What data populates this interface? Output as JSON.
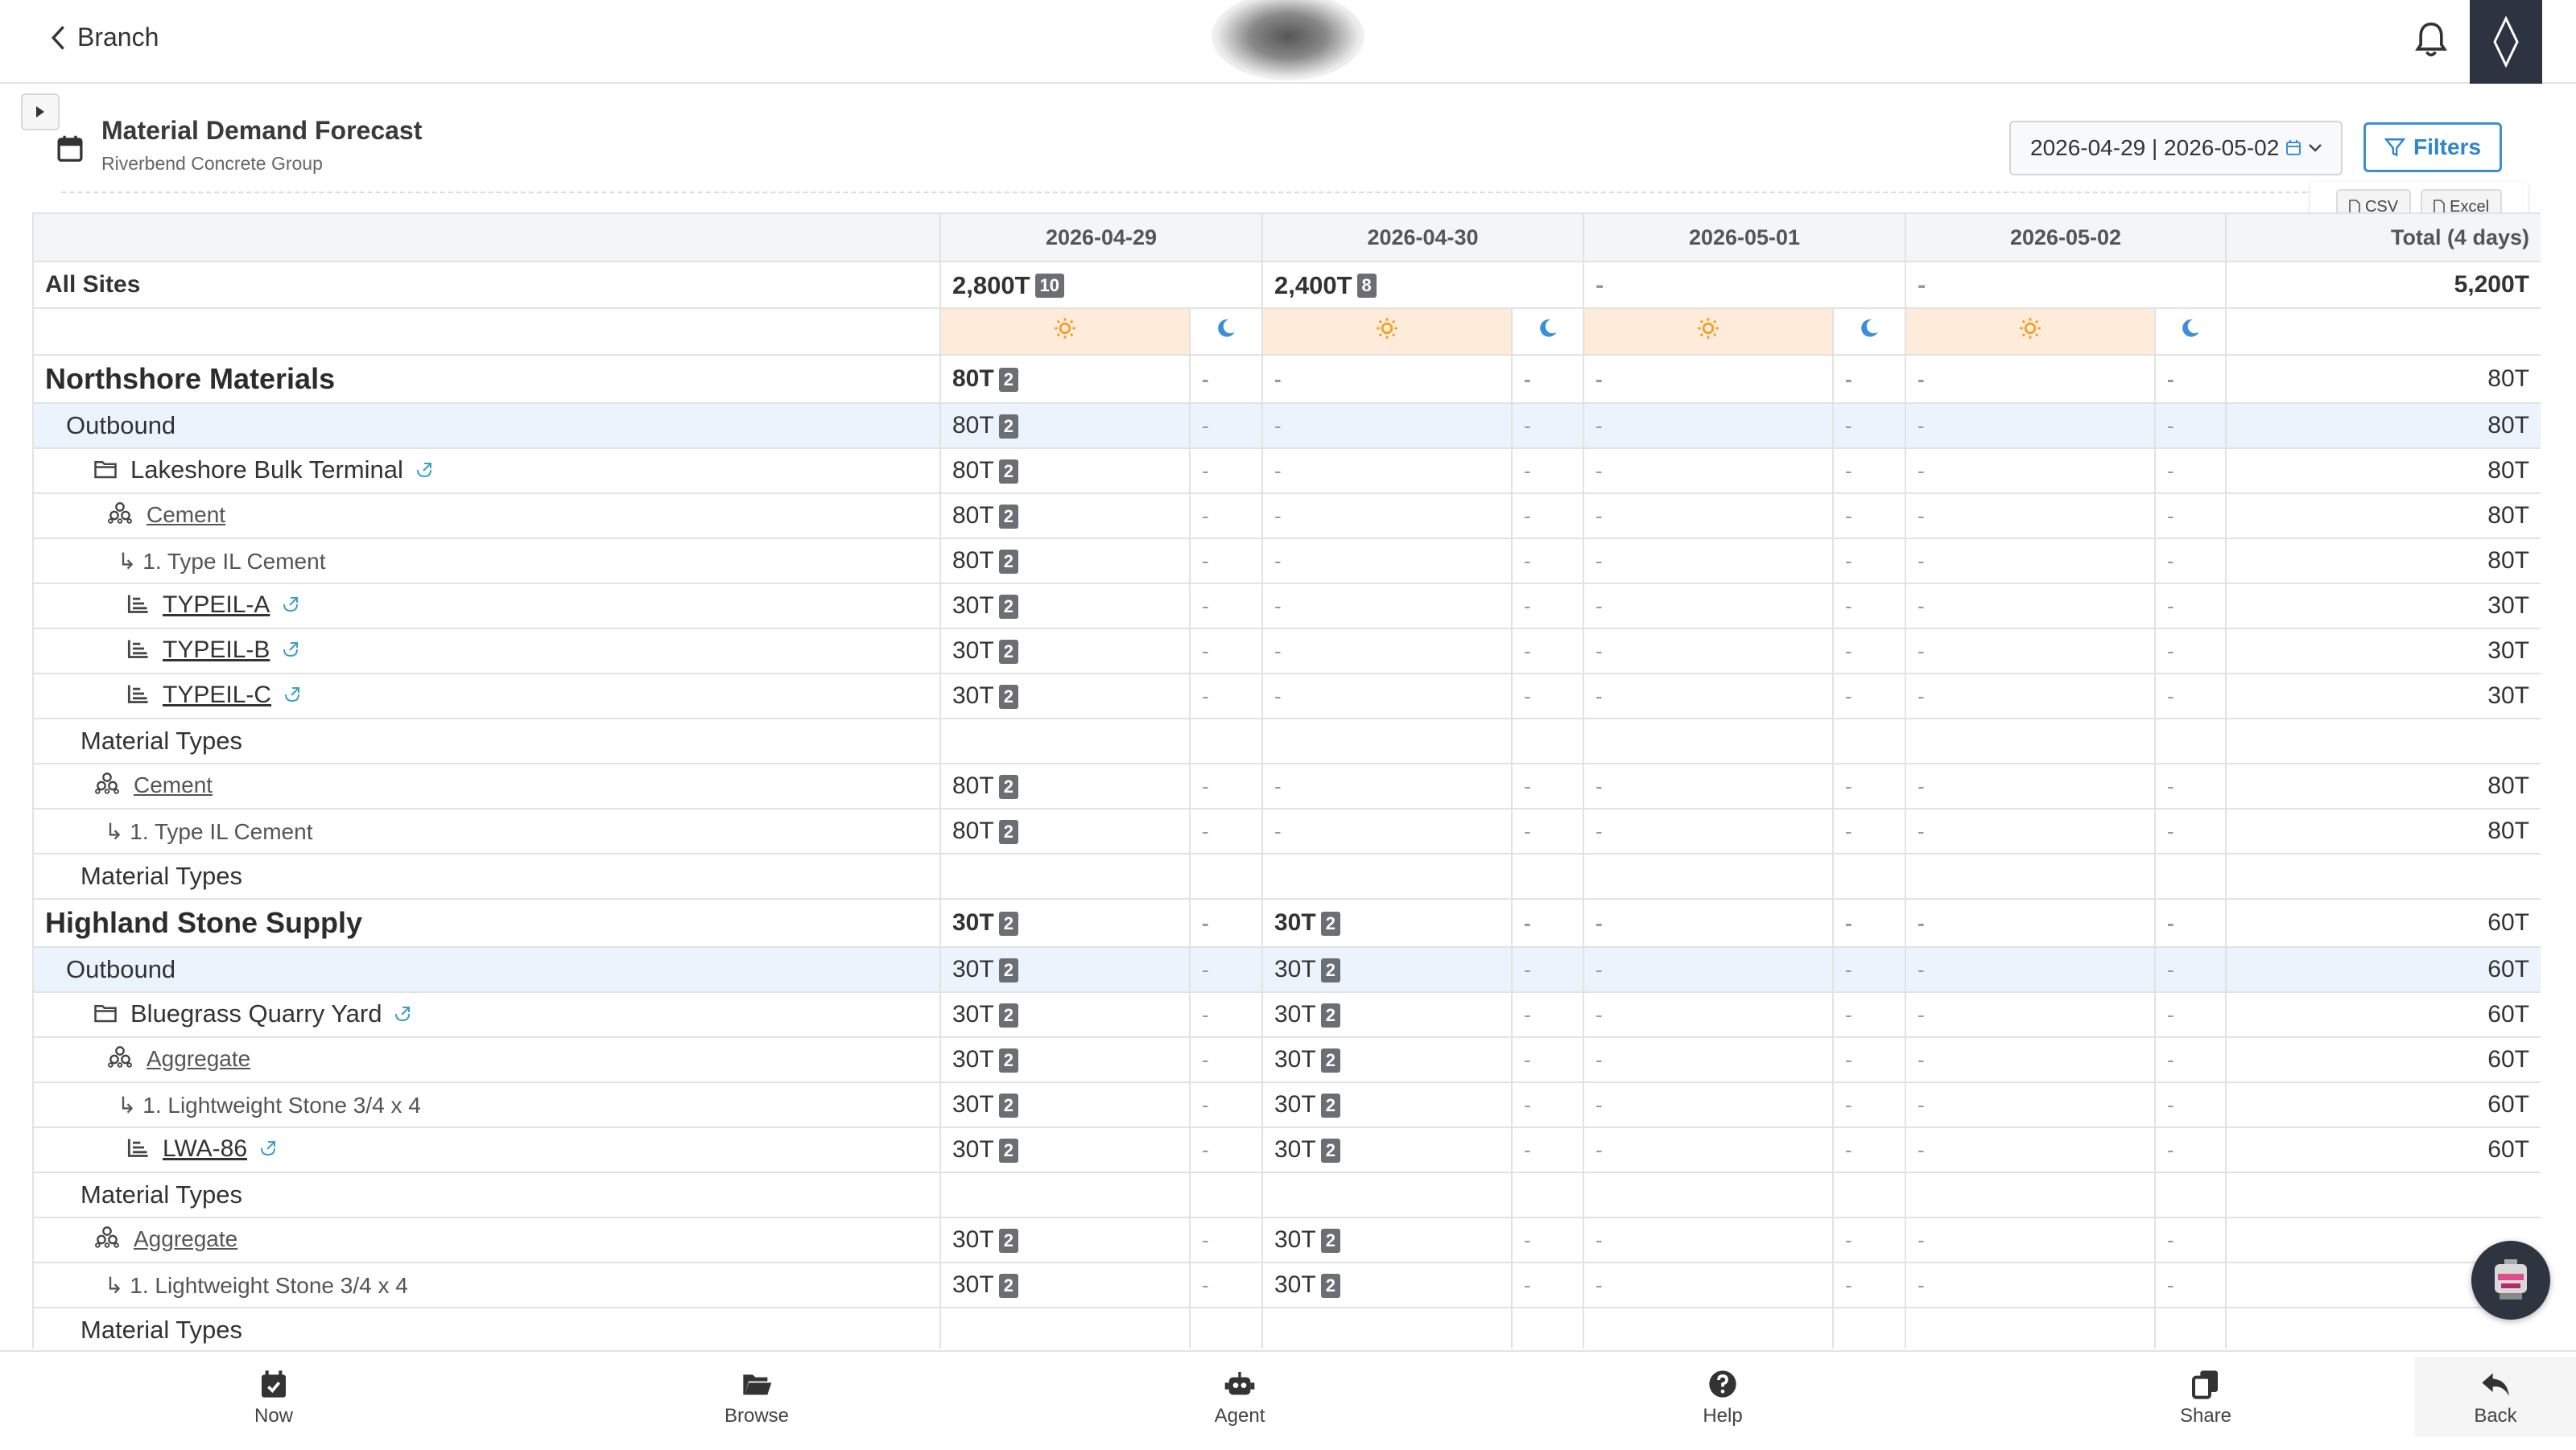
{
  "topbar": {
    "back_label": "Branch"
  },
  "header": {
    "title": "Material Demand Forecast",
    "subtitle": "Riverbend Concrete Group",
    "date_range": "2026-04-29 | 2026-05-02",
    "filters_label": "Filters",
    "export_csv": "CSV",
    "export_excel": "Excel"
  },
  "table": {
    "dates": [
      "2026-04-29",
      "2026-04-30",
      "2026-05-01",
      "2026-05-02"
    ],
    "total_header": "Total (4 days)",
    "all_sites": {
      "label": "All Sites",
      "values": [
        {
          "v": "2,800T",
          "b": "10"
        },
        {
          "v": "2,400T",
          "b": "8"
        },
        {
          "v": "-",
          "b": ""
        },
        {
          "v": "-",
          "b": ""
        }
      ],
      "total": "5,200T"
    },
    "rows": [
      {
        "kind": "company",
        "label": "Northshore Materials",
        "cells": [
          "80T|2",
          "-",
          "-",
          "-",
          "-",
          "-",
          "-",
          "-"
        ],
        "total": "80T"
      },
      {
        "kind": "outbound",
        "label": "Outbound",
        "cells": [
          "80T|2",
          "-",
          "-",
          "-",
          "-",
          "-",
          "-",
          "-"
        ],
        "total": "80T"
      },
      {
        "kind": "site",
        "label": "Lakeshore Bulk Terminal",
        "cells": [
          "80T|2",
          "-",
          "-",
          "-",
          "-",
          "-",
          "-",
          "-"
        ],
        "total": "80T"
      },
      {
        "kind": "category",
        "label": "Cement",
        "cells": [
          "80T|2",
          "-",
          "-",
          "-",
          "-",
          "-",
          "-",
          "-"
        ],
        "total": "80T"
      },
      {
        "kind": "subtype",
        "label": "↳ 1. Type IL Cement",
        "cells": [
          "80T|2",
          "-",
          "-",
          "-",
          "-",
          "-",
          "-",
          "-"
        ],
        "total": "80T"
      },
      {
        "kind": "item",
        "label": "TYPEIL-A",
        "cells": [
          "30T|2",
          "-",
          "-",
          "-",
          "-",
          "-",
          "-",
          "-"
        ],
        "total": "30T"
      },
      {
        "kind": "item",
        "label": "TYPEIL-B",
        "cells": [
          "30T|2",
          "-",
          "-",
          "-",
          "-",
          "-",
          "-",
          "-"
        ],
        "total": "30T"
      },
      {
        "kind": "item",
        "label": "TYPEIL-C",
        "cells": [
          "30T|2",
          "-",
          "-",
          "-",
          "-",
          "-",
          "-",
          "-"
        ],
        "total": "30T"
      },
      {
        "kind": "section",
        "label": "Material Types",
        "cells": [
          "",
          "",
          "",
          "",
          "",
          "",
          "",
          ""
        ],
        "total": ""
      },
      {
        "kind": "mtcategory",
        "label": "Cement",
        "cells": [
          "80T|2",
          "-",
          "-",
          "-",
          "-",
          "-",
          "-",
          "-"
        ],
        "total": "80T"
      },
      {
        "kind": "mtsubtype",
        "label": "↳ 1. Type IL Cement",
        "cells": [
          "80T|2",
          "-",
          "-",
          "-",
          "-",
          "-",
          "-",
          "-"
        ],
        "total": "80T"
      },
      {
        "kind": "section",
        "label": "Material Types",
        "cells": [
          "",
          "",
          "",
          "",
          "",
          "",
          "",
          ""
        ],
        "total": ""
      },
      {
        "kind": "company",
        "label": "Highland Stone Supply",
        "cells": [
          "30T|2",
          "-",
          "30T|2",
          "-",
          "-",
          "-",
          "-",
          "-"
        ],
        "total": "60T"
      },
      {
        "kind": "outbound",
        "label": "Outbound",
        "cells": [
          "30T|2",
          "-",
          "30T|2",
          "-",
          "-",
          "-",
          "-",
          "-"
        ],
        "total": "60T"
      },
      {
        "kind": "site",
        "label": "Bluegrass Quarry Yard",
        "cells": [
          "30T|2",
          "-",
          "30T|2",
          "-",
          "-",
          "-",
          "-",
          "-"
        ],
        "total": "60T"
      },
      {
        "kind": "category",
        "label": "Aggregate",
        "cells": [
          "30T|2",
          "-",
          "30T|2",
          "-",
          "-",
          "-",
          "-",
          "-"
        ],
        "total": "60T"
      },
      {
        "kind": "subtype",
        "label": "↳ 1. Lightweight Stone 3/4 x 4",
        "cells": [
          "30T|2",
          "-",
          "30T|2",
          "-",
          "-",
          "-",
          "-",
          "-"
        ],
        "total": "60T"
      },
      {
        "kind": "item",
        "label": "LWA-86",
        "cells": [
          "30T|2",
          "-",
          "30T|2",
          "-",
          "-",
          "-",
          "-",
          "-"
        ],
        "total": "60T"
      },
      {
        "kind": "section",
        "label": "Material Types",
        "cells": [
          "",
          "",
          "",
          "",
          "",
          "",
          "",
          ""
        ],
        "total": ""
      },
      {
        "kind": "mtcategory",
        "label": "Aggregate",
        "cells": [
          "30T|2",
          "-",
          "30T|2",
          "-",
          "-",
          "-",
          "-",
          "-"
        ],
        "total": ""
      },
      {
        "kind": "mtsubtype",
        "label": "↳ 1. Lightweight Stone 3/4 x 4",
        "cells": [
          "30T|2",
          "-",
          "30T|2",
          "-",
          "-",
          "-",
          "-",
          "-"
        ],
        "total": ""
      },
      {
        "kind": "section",
        "label": "Material Types",
        "cells": [
          "",
          "",
          "",
          "",
          "",
          "",
          "",
          ""
        ],
        "total": ""
      }
    ]
  },
  "bottom_nav": [
    {
      "label": "Now",
      "icon": "calendar-check-icon"
    },
    {
      "label": "Browse",
      "icon": "folder-open-icon"
    },
    {
      "label": "Agent",
      "icon": "robot-icon"
    },
    {
      "label": "Help",
      "icon": "question-circle-icon"
    },
    {
      "label": "Share",
      "icon": "copy-icon"
    },
    {
      "label": "Back",
      "icon": "reply-arrow-icon"
    }
  ],
  "colors": {
    "accent": "#2f86cc",
    "day_shift_bg": "#fdecd9",
    "sun": "#f0a030",
    "moon": "#3a8fd6",
    "outbound_bg": "#ebf4fc",
    "badge": "#6b6e74",
    "brand_tile": "#2d3340"
  }
}
